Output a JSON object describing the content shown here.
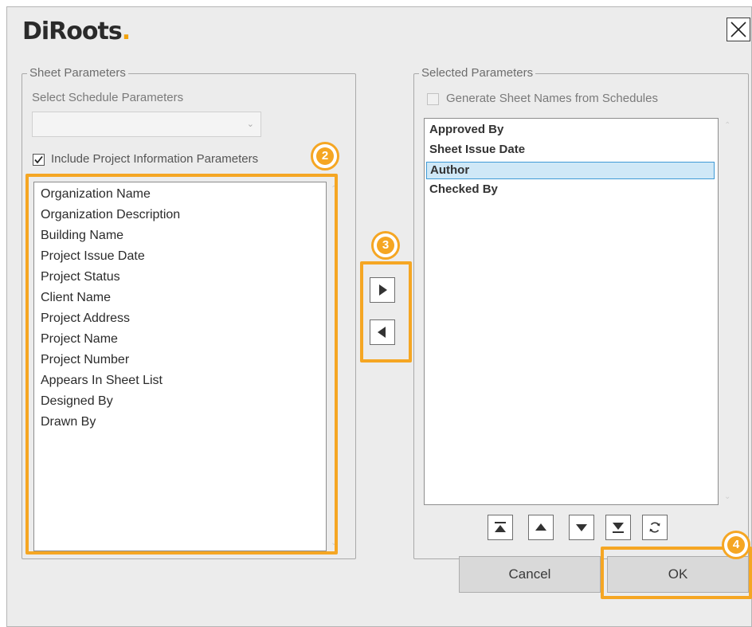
{
  "app": {
    "logo_text": "DiRoots",
    "logo_dot": "."
  },
  "colors": {
    "accent_orange": "#f5a623",
    "selection_bg": "#cfe8f7",
    "selection_border": "#3f9ad6"
  },
  "sheet_parameters": {
    "title": "Sheet Parameters",
    "schedule_label": "Select Schedule Parameters",
    "schedule_value": "",
    "include_label": "Include Project Information Parameters",
    "include_checked": true,
    "items": [
      "Organization Name",
      "Organization Description",
      "Building Name",
      "Project Issue Date",
      "Project Status",
      "Client Name",
      "Project Address",
      "Project Name",
      "Project Number",
      "Appears In Sheet List",
      "Designed By",
      "Drawn By"
    ]
  },
  "selected_parameters": {
    "title": "Selected Parameters",
    "generate_label": "Generate Sheet Names from Schedules",
    "generate_checked": false,
    "items": [
      "Approved By",
      "Sheet Issue Date",
      "Author",
      "Checked By"
    ],
    "selected_index": 2
  },
  "order_buttons": [
    "move-to-top-icon",
    "move-up-icon",
    "move-down-icon",
    "move-to-bottom-icon",
    "refresh-icon"
  ],
  "transfer_buttons": [
    "arrow-right-icon",
    "arrow-left-icon"
  ],
  "badges": {
    "list": "2",
    "transfer": "3",
    "ok": "4"
  },
  "buttons": {
    "cancel": "Cancel",
    "ok": "OK"
  }
}
